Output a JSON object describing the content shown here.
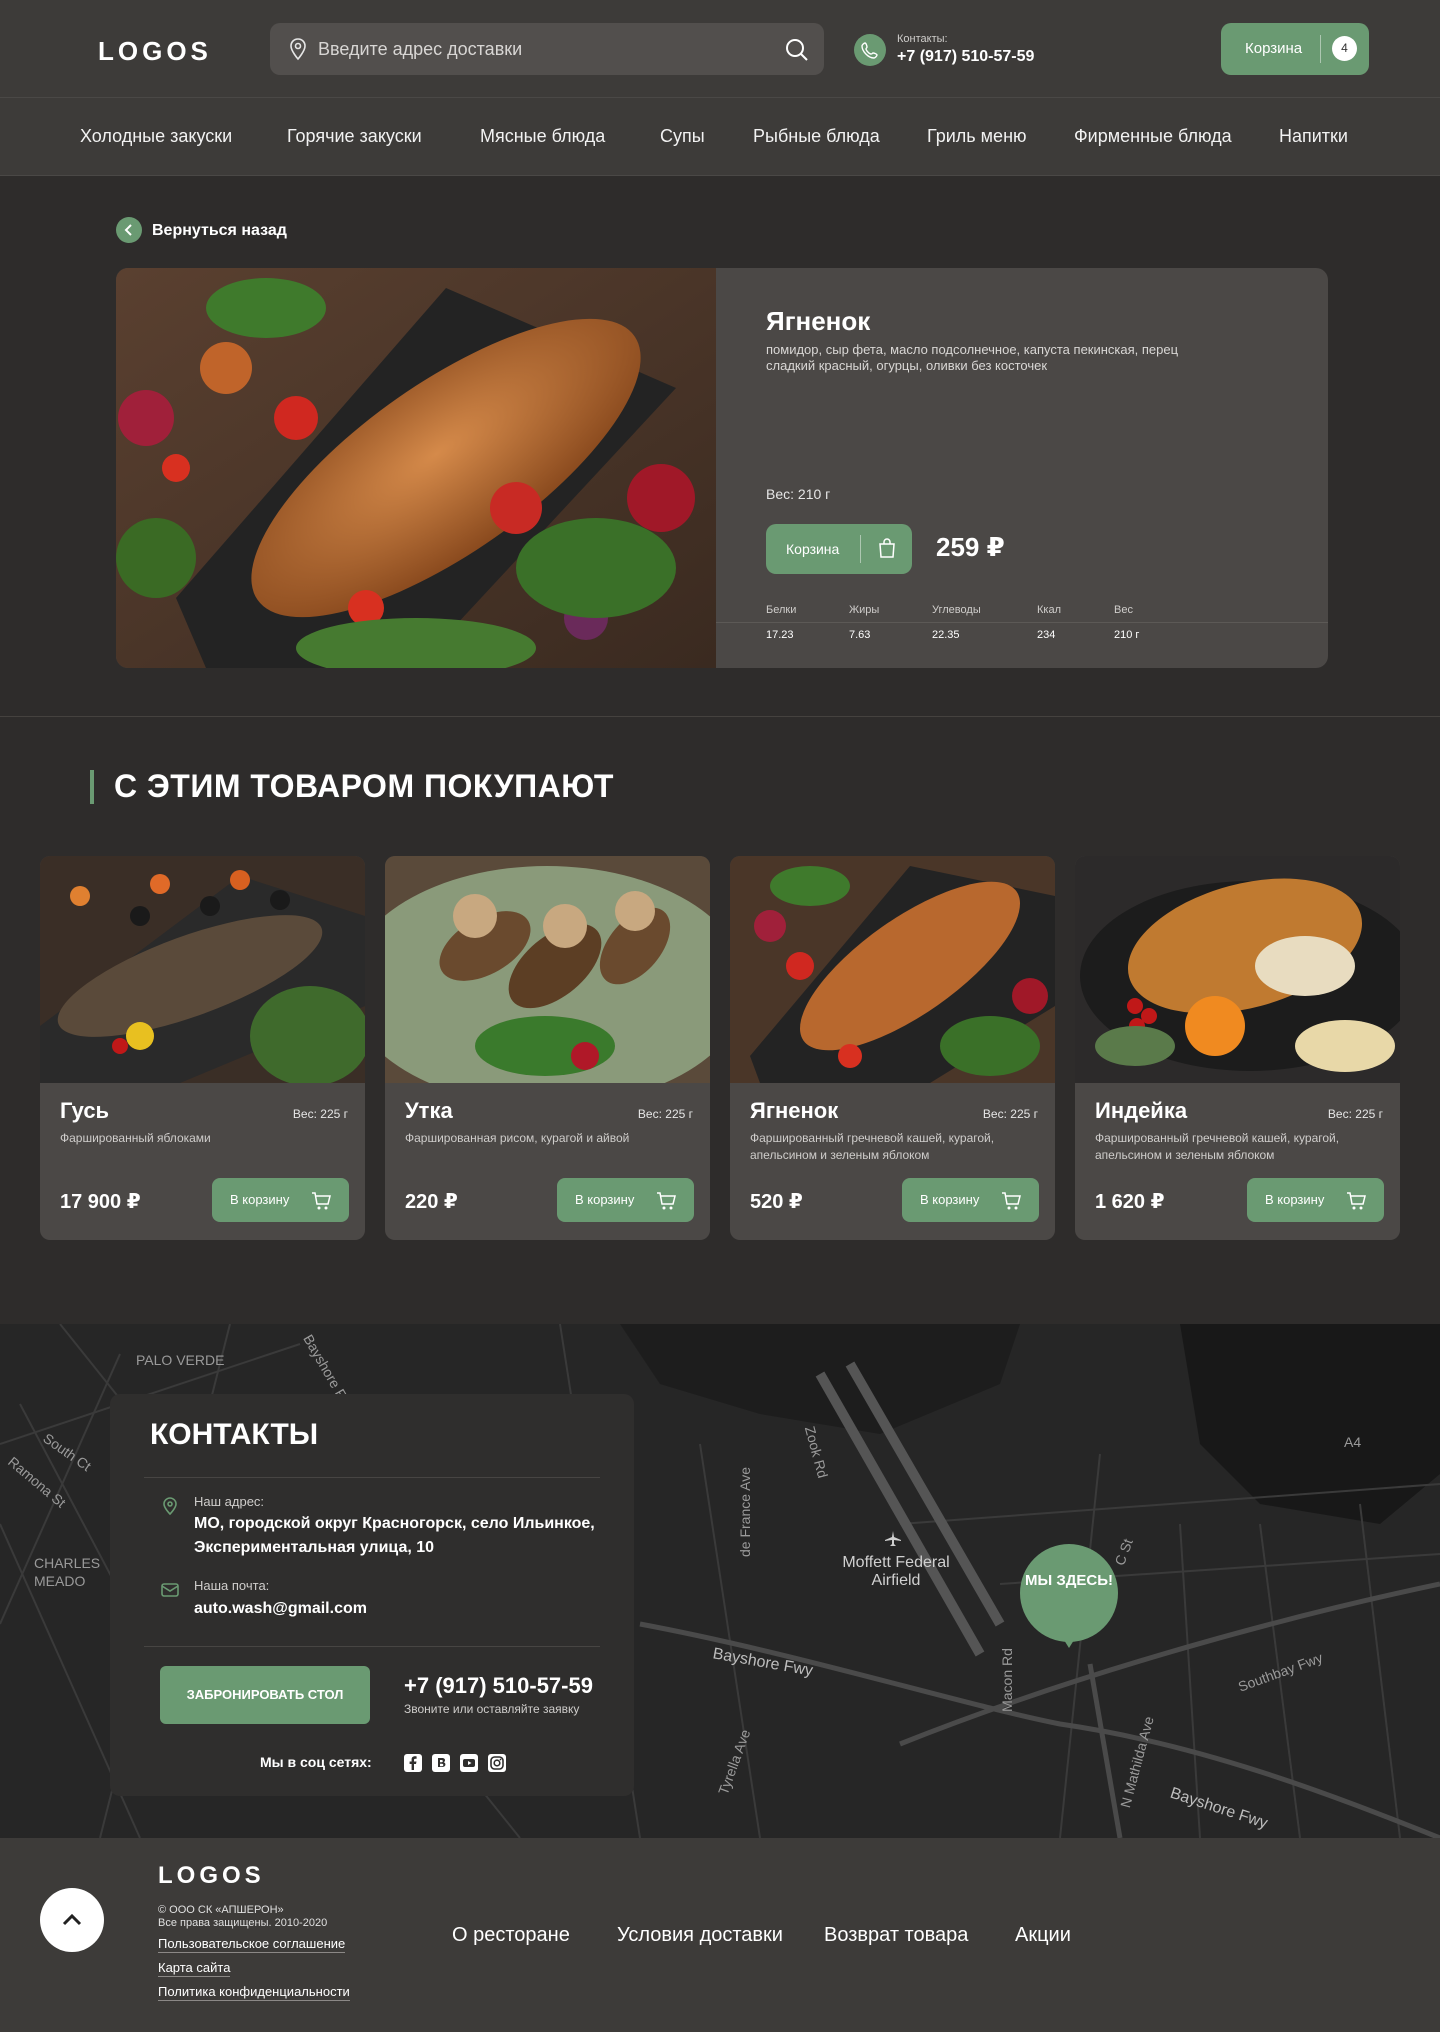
{
  "header": {
    "logo": "LOGOS",
    "search_placeholder": "Введите адрес доставки",
    "contact_label": "Контакты:",
    "contact_phone": "+7 (917) 510-57-59",
    "cart_label": "Корзина",
    "cart_count": "4"
  },
  "nav": [
    "Холодные закуски",
    "Горячие закуски",
    "Мясные блюда",
    "Супы",
    "Рыбные блюда",
    "Гриль меню",
    "Фирменные блюда",
    "Напитки"
  ],
  "back_label": "Вернуться назад",
  "product": {
    "title": "Ягненок",
    "description": "помидор, сыр фета, масло подсолнечное, капуста пекинская, перец сладкий красный, огурцы, оливки без косточек",
    "weight": "Вес: 210 г",
    "cart_label": "Корзина",
    "price": "259 ₽",
    "nutrition": [
      {
        "label": "Белки",
        "value": "17.23"
      },
      {
        "label": "Жиры",
        "value": "7.63"
      },
      {
        "label": "Углеводы",
        "value": "22.35"
      },
      {
        "label": "Ккал",
        "value": "234"
      },
      {
        "label": "Вес",
        "value": "210 г"
      }
    ]
  },
  "related": {
    "title": "С ЭТИМ ТОВАРОМ ПОКУПАЮТ",
    "items": [
      {
        "name": "Гусь",
        "weight": "Вес: 225 г",
        "desc": "Фаршированный яблоками",
        "price": "17 900 ₽",
        "button": "В корзину"
      },
      {
        "name": "Утка",
        "weight": "Вес: 225 г",
        "desc": "Фаршированная рисом, курагой и айвой",
        "price": "220 ₽",
        "button": "В корзину"
      },
      {
        "name": "Ягненок",
        "weight": "Вес: 225 г",
        "desc": "Фаршированный гречневой кашей, курагой, апельсином и зеленым яблоком",
        "price": "520 ₽",
        "button": "В корзину"
      },
      {
        "name": "Индейка",
        "weight": "Вес: 225 г",
        "desc": "Фаршированный гречневой кашей, курагой, апельсином и зеленым яблоком",
        "price": "1 620 ₽",
        "button": "В корзину"
      }
    ]
  },
  "contacts": {
    "title": "КОНТАКТЫ",
    "address_label": "Наш адрес:",
    "address": "МО, городской округ Красногорск, село Ильинкое, Экспериментальная улица, 10",
    "email_label": "Наша почта:",
    "email": "auto.wash@gmail.com",
    "book_button": "ЗАБРОНИРОВАТЬ СТОЛ",
    "phone": "+7 (917) 510-57-59",
    "phone_sub": "Звоните или оставляйте заявку",
    "social_label": "Мы в соц сетях:",
    "socials": [
      "facebook-icon",
      "vk-icon",
      "youtube-icon",
      "instagram-icon"
    ]
  },
  "map": {
    "marker": "МЫ ЗДЕСЬ!",
    "labels": [
      "PALO VERDE",
      "Bayshore Fwy",
      "South Ct",
      "Ramona St",
      "CHARLES MEADO",
      "Zook Rd",
      "de France Ave",
      "Moffett Federal Airfield",
      "Macon Rd",
      "C St",
      "Southbay Fwy",
      "Tyrella Ave",
      "N Mathilda Ave",
      "A4"
    ]
  },
  "footer": {
    "logo": "LOGOS",
    "copyright": "© ООО СК «АПШЕРОН»\nВсе права защищены. 2010-2020",
    "links": [
      "Пользовательское соглашение",
      "Карта сайта",
      "Политика конфиденциальности"
    ],
    "nav": [
      "О ресторане",
      "Условия доставки",
      "Возврат товара",
      "Акции"
    ]
  },
  "colors": {
    "accent": "#6a9a72",
    "panel": "#4b4846",
    "header": "#3d3b39",
    "background": "#2e2c2b"
  }
}
